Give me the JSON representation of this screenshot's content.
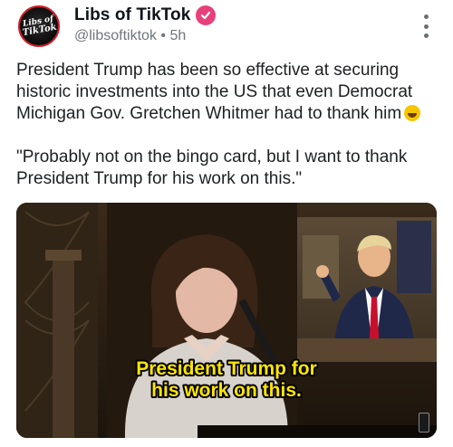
{
  "author": {
    "display_name": "Libs of TikTok",
    "handle": "@libsoftiktok",
    "separator": "•",
    "time": "5h",
    "avatar_text_top": "Libs of",
    "avatar_text_bottom": "TikTok"
  },
  "post": {
    "paragraph1": "President Trump has been so effective at securing historic investments into the US that even Democrat Michigan Gov. Gretchen Whitmer had to thank him",
    "paragraph2": "\"Probably not on the bingo card, but I want to thank President Trump for his work on this.\""
  },
  "media": {
    "caption_line1": "President Trump for",
    "caption_line2": "his work on this."
  },
  "icons": {
    "verified": "verified-badge-icon",
    "more": "more-vertical-icon",
    "emoji": "rolling-on-floor-laughing-emoji",
    "watermark": "video-watermark-icon"
  },
  "colors": {
    "verified_badge": "#e8407a",
    "caption_text": "#ffe600",
    "handle_text": "#6e767d"
  }
}
